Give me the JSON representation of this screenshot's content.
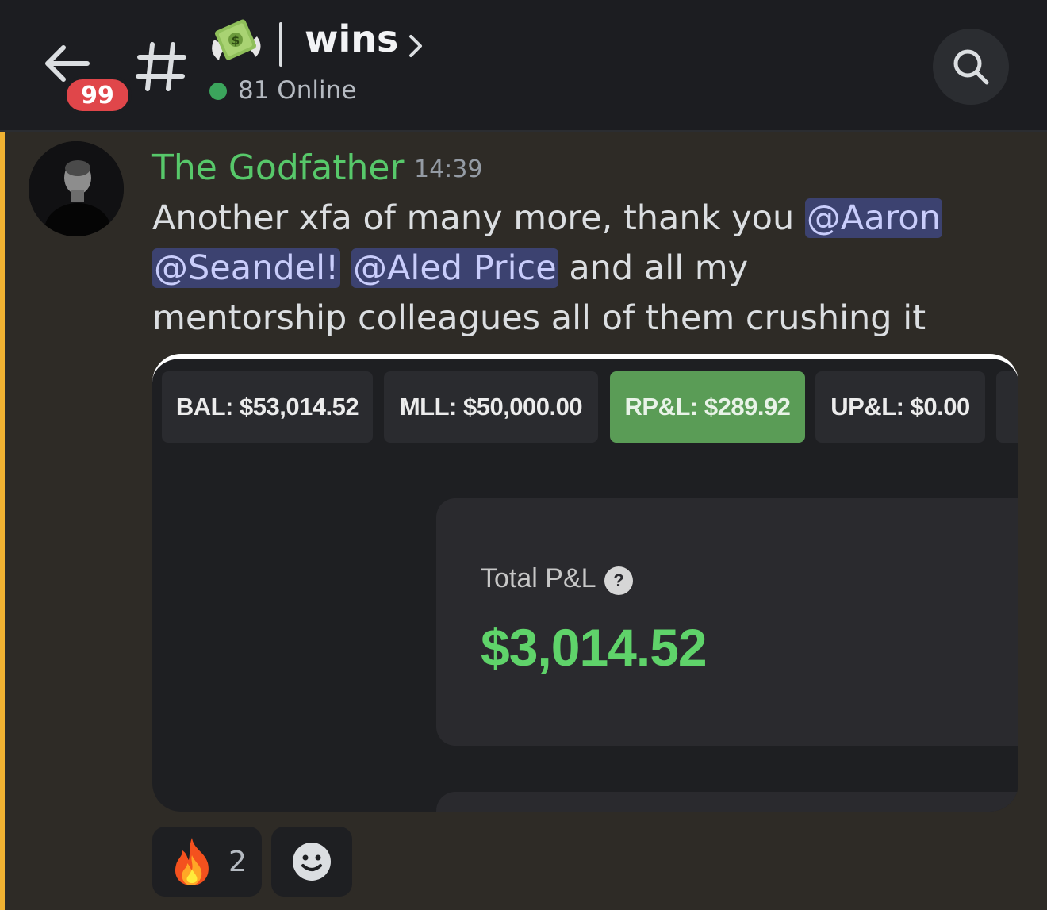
{
  "header": {
    "unread_badge": "99",
    "channel_separator": "|",
    "channel_name": "wins",
    "online_count": "81 Online",
    "icons": {
      "back": "arrow-left-icon",
      "hash": "hash-icon",
      "channel_emoji": "money-with-wings-icon",
      "chevron": "chevron-right-icon",
      "search": "search-icon"
    }
  },
  "message": {
    "author": "The Godfather",
    "timestamp": "14:39",
    "text_part_1": "Another xfa of many more, thank you ",
    "mention_1": "@Aaron",
    "mention_2": "@Seandel!",
    "mention_3": "@Aled Price",
    "text_part_2": " and all my mentorship colleagues all of them crushing it",
    "author_color": "#57c86a"
  },
  "embed": {
    "stats": [
      {
        "label": "BAL: $53,014.52"
      },
      {
        "label": "MLL: $50,000.00"
      },
      {
        "label": "RP&L: $289.92"
      },
      {
        "label": "UP&L: $0.00"
      }
    ],
    "active_stat_color": "#5a9c56",
    "pnl_label": "Total P&L",
    "pnl_help": "?",
    "pnl_value": "$3,014.52",
    "pnl_value_color": "#5fd36a"
  },
  "reactions": [
    {
      "emoji": "fire-icon",
      "count": "2"
    },
    {
      "emoji": "add-reaction-smiley-icon"
    }
  ],
  "colors": {
    "header_bg": "#1c1d21",
    "message_bg": "#2e2b26",
    "highlight_bar": "#f0b232",
    "mention_bg": "#3c4270"
  }
}
